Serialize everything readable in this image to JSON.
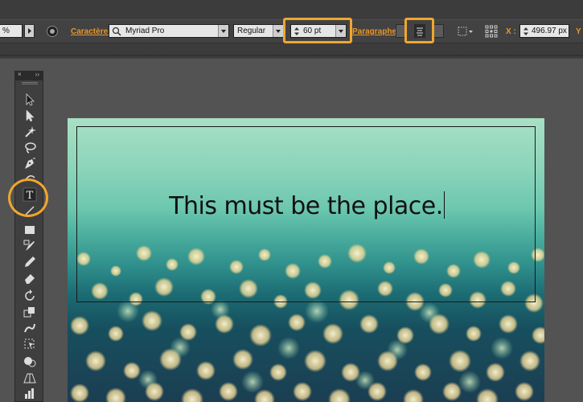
{
  "control_bar": {
    "opacity_value": "%",
    "character_label": "Caractère :",
    "font_family": "Myriad Pro",
    "font_style": "Regular",
    "font_size": "60 pt",
    "paragraph_label": "Paragraphe :",
    "x_label": "X :",
    "x_value": "496.97 px",
    "y_label": "Y :"
  },
  "tools_panel": {
    "collapse_glyph": "››",
    "close_glyph": "×",
    "tools": [
      "selection",
      "direct-selection",
      "magic-wand",
      "lasso",
      "pen",
      "curvature",
      "type",
      "line-segment",
      "rectangle",
      "paintbrush",
      "pencil",
      "eraser",
      "rotate",
      "scale",
      "warp",
      "free-transform",
      "shape-builder",
      "perspective",
      "graph"
    ]
  },
  "canvas": {
    "headline": "This must be the place."
  },
  "colors": {
    "highlight": "#f0a630",
    "accent_label": "#e8962a"
  }
}
